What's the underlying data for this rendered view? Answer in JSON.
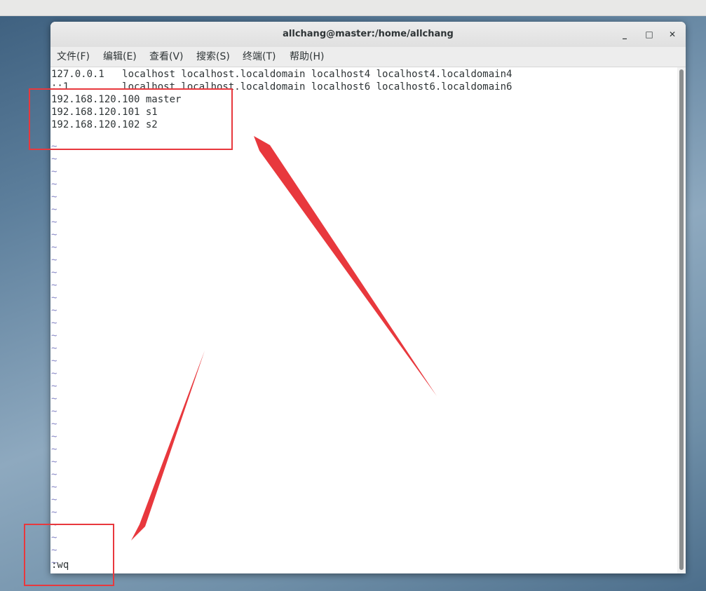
{
  "window": {
    "title": "allchang@master:/home/allchang"
  },
  "window_controls": {
    "minimize": "_",
    "maximize": "□",
    "close": "✕"
  },
  "menu": [
    "文件(F)",
    "编辑(E)",
    "查看(V)",
    "搜索(S)",
    "终端(T)",
    "帮助(H)"
  ],
  "terminal": {
    "lines": [
      "127.0.0.1   localhost localhost.localdomain localhost4 localhost4.localdomain4",
      "::1         localhost localhost.localdomain localhost6 localhost6.localdomain6",
      "192.168.120.100 master",
      "192.168.120.101 s1",
      "192.168.120.102 s2"
    ],
    "tilde": "~",
    "tilde_count": 34,
    "command": ":wq"
  },
  "annotation_color": "#e8383d"
}
